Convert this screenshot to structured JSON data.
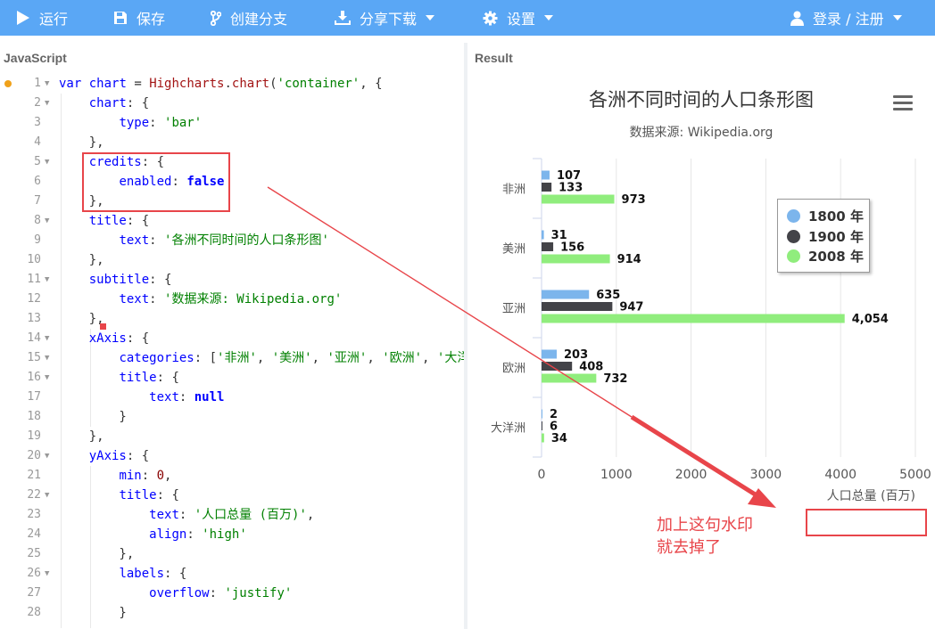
{
  "toolbar": {
    "run": "运行",
    "save": "保存",
    "fork": "创建分支",
    "share": "分享下载",
    "settings": "设置",
    "login": "登录 / 注册"
  },
  "panes": {
    "left_title": "JavaScript",
    "right_title": "Result"
  },
  "code_lines": [
    {
      "n": "1",
      "fold": true,
      "html": "<span class=\"kw\">var</span> <span class=\"prop\">chart</span> = <span class=\"fn\">Highcharts</span>.<span class=\"fn\">chart</span>(<span class=\"str\">'container'</span>, {"
    },
    {
      "n": "2",
      "fold": true,
      "html": "    <span class=\"prop\">chart</span>: {"
    },
    {
      "n": "3",
      "fold": false,
      "html": "        <span class=\"prop\">type</span>: <span class=\"str\">'bar'</span>"
    },
    {
      "n": "4",
      "fold": false,
      "html": "    },"
    },
    {
      "n": "5",
      "fold": true,
      "html": "    <span class=\"prop\">credits</span>: {"
    },
    {
      "n": "6",
      "fold": false,
      "html": "        <span class=\"prop\">enabled</span>: <span class=\"kw bold\">false</span>"
    },
    {
      "n": "7",
      "fold": false,
      "html": "    },"
    },
    {
      "n": "8",
      "fold": true,
      "html": "    <span class=\"prop\">title</span>: {"
    },
    {
      "n": "9",
      "fold": false,
      "html": "        <span class=\"prop\">text</span>: <span class=\"str\">'各洲不同时间的人口条形图'</span>"
    },
    {
      "n": "10",
      "fold": false,
      "html": "    },"
    },
    {
      "n": "11",
      "fold": true,
      "html": "    <span class=\"prop\">subtitle</span>: {"
    },
    {
      "n": "12",
      "fold": false,
      "html": "        <span class=\"prop\">text</span>: <span class=\"str\">'数据来源: Wikipedia.org'</span>"
    },
    {
      "n": "13",
      "fold": false,
      "html": "    },"
    },
    {
      "n": "14",
      "fold": true,
      "html": "    <span class=\"prop\">xAxis</span>: {"
    },
    {
      "n": "15",
      "fold": true,
      "html": "        <span class=\"prop\">categories</span>: [<span class=\"str\">'非洲'</span>, <span class=\"str\">'美洲'</span>, <span class=\"str\">'亚洲'</span>, <span class=\"str\">'欧洲'</span>, <span class=\"str\">'大洋洲'</span>],"
    },
    {
      "n": "16",
      "fold": true,
      "html": "        <span class=\"prop\">title</span>: {"
    },
    {
      "n": "17",
      "fold": false,
      "html": "            <span class=\"prop\">text</span>: <span class=\"kw bold\">null</span>"
    },
    {
      "n": "18",
      "fold": false,
      "html": "        }"
    },
    {
      "n": "19",
      "fold": false,
      "html": "    },"
    },
    {
      "n": "20",
      "fold": true,
      "html": "    <span class=\"prop\">yAxis</span>: {"
    },
    {
      "n": "21",
      "fold": false,
      "html": "        <span class=\"prop\">min</span>: <span class=\"num\">0</span>,"
    },
    {
      "n": "22",
      "fold": true,
      "html": "        <span class=\"prop\">title</span>: {"
    },
    {
      "n": "23",
      "fold": false,
      "html": "            <span class=\"prop\">text</span>: <span class=\"str\">'人口总量 (百万)'</span>,"
    },
    {
      "n": "24",
      "fold": false,
      "html": "            <span class=\"prop\">align</span>: <span class=\"str\">'high'</span>"
    },
    {
      "n": "25",
      "fold": false,
      "html": "        },"
    },
    {
      "n": "26",
      "fold": true,
      "html": "        <span class=\"prop\">labels</span>: {"
    },
    {
      "n": "27",
      "fold": false,
      "html": "            <span class=\"prop\">overflow</span>: <span class=\"str\">'justify'</span>"
    },
    {
      "n": "28",
      "fold": false,
      "html": "        }"
    }
  ],
  "chart_data": {
    "type": "bar",
    "title": "各洲不同时间的人口条形图",
    "subtitle": "数据来源: Wikipedia.org",
    "categories": [
      "非洲",
      "美洲",
      "亚洲",
      "欧洲",
      "大洋洲"
    ],
    "series": [
      {
        "name": "1800 年",
        "color": "#7cb5ec",
        "values": [
          107,
          31,
          635,
          203,
          2
        ]
      },
      {
        "name": "1900 年",
        "color": "#434348",
        "values": [
          133,
          156,
          947,
          408,
          6
        ]
      },
      {
        "name": "2008 年",
        "color": "#90ed7d",
        "values": [
          973,
          914,
          4054,
          732,
          34
        ]
      }
    ],
    "value_labels": [
      [
        "107",
        "31",
        "635",
        "203",
        "2"
      ],
      [
        "133",
        "156",
        "947",
        "408",
        "6"
      ],
      [
        "973",
        "914",
        "4,054",
        "732",
        "34"
      ]
    ],
    "xlabel": "",
    "ylabel": "人口总量 (百万)",
    "ylim": [
      0,
      5000
    ],
    "yticks": [
      "0",
      "1000",
      "2000",
      "3000",
      "4000",
      "5000"
    ],
    "legend": "top-right, inside plot, with border",
    "grid": true
  },
  "annotation": {
    "text_line1": "加上这句水印",
    "text_line2": "就去掉了",
    "color": "#e8454a"
  }
}
